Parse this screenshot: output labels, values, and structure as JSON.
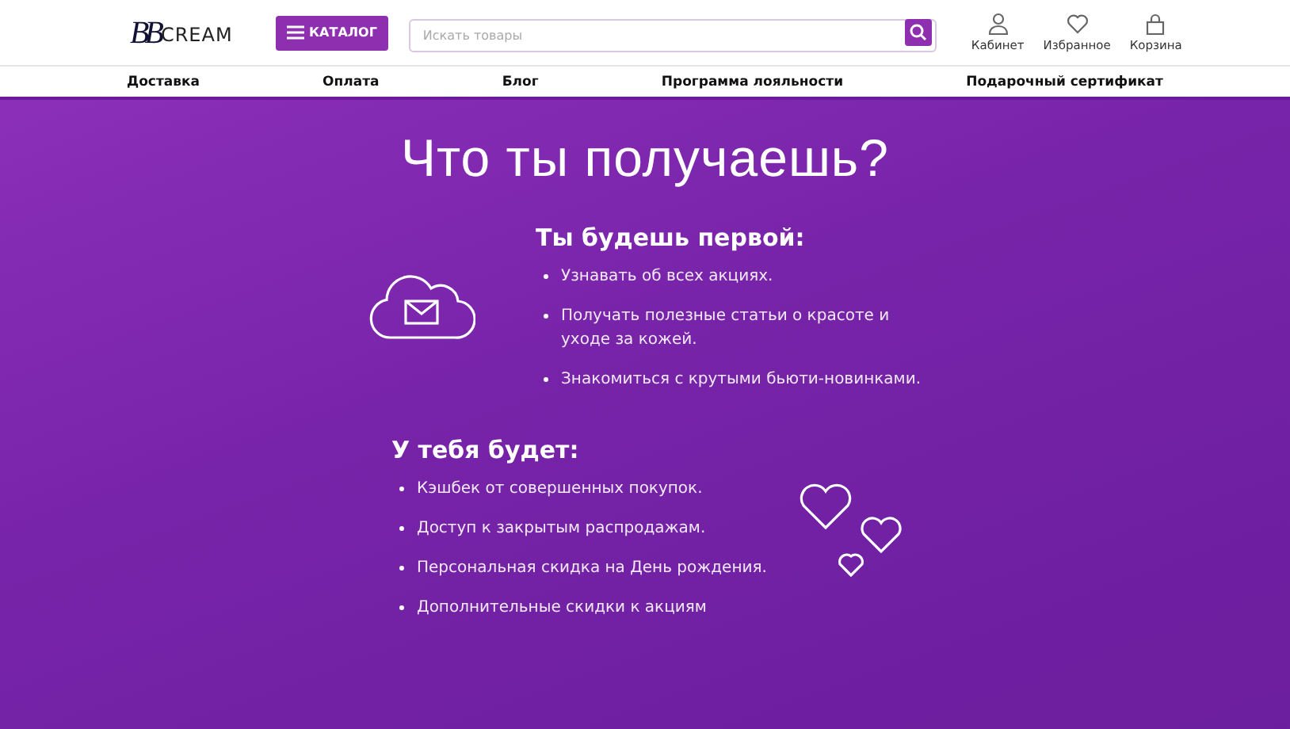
{
  "header": {
    "logo": {
      "mark": "BB",
      "word": "CREAM"
    },
    "catalog_button": "КАТАЛОГ",
    "search": {
      "placeholder": "Искать товары"
    },
    "actions": [
      {
        "kind": "user",
        "label": "Кабинет"
      },
      {
        "kind": "heart",
        "label": "Избранное"
      },
      {
        "kind": "bag",
        "label": "Корзина"
      }
    ]
  },
  "nav": [
    "Доставка",
    "Оплата",
    "Блог",
    "Программа лояльности",
    "Подарочный сертификат"
  ],
  "hero": {
    "title": "Что ты получаешь?",
    "block_1": {
      "heading": "Ты будешь первой:",
      "items": [
        "Узнавать об всех акциях.",
        "Получать полезные статьи о красоте и уходе за кожей.",
        "Знакомиться с крутыми бьюти-новинками."
      ]
    },
    "block_2": {
      "heading": "У тебя будет:",
      "items": [
        "Кэшбек от совершенных покупок.",
        "Доступ к закрытым распродажам.",
        "Персональная скидка на День рождения.",
        "Дополнительные скидки к акциям"
      ]
    }
  }
}
